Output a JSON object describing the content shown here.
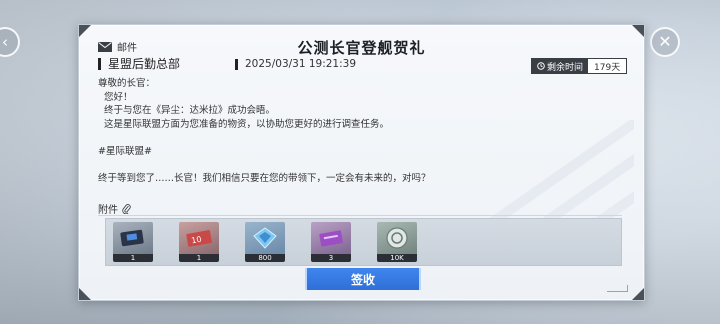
{
  "mail": {
    "label": "邮件",
    "title": "公测长官登舰贺礼",
    "sender": "星盟后勤总部",
    "date": "2025/03/31 19:21:39",
    "remaining_label": "剩余时间",
    "remaining_value": "179天",
    "body": {
      "greeting": "尊敬的长官：",
      "line1": "  您好！",
      "line2": "  终于与您在《异尘：达米拉》成功会晤。",
      "line3": "  这是星际联盟方面为您准备的物资，以协助您更好的进行调查任务。",
      "tag": "#星际联盟#",
      "closing": "终于等到您了……长官！我们相信只要在您的带领下，一定会有未来的，对吗？"
    },
    "attachments_label": "附件",
    "attachments": [
      {
        "icon": "dark-ticket-card-icon",
        "qty": "1",
        "color": "#3a4a66"
      },
      {
        "icon": "red-ticket-icon",
        "qty": "1",
        "color": "#b44a4a"
      },
      {
        "icon": "blue-crystal-icon",
        "qty": "800",
        "color": "#5aa8e6"
      },
      {
        "icon": "purple-card-icon",
        "qty": "3",
        "color": "#8a4ab0"
      },
      {
        "icon": "silver-coin-icon",
        "qty": "10K",
        "color": "#8fa39a"
      }
    ],
    "claim_button": "签收"
  },
  "colors": {
    "accent": "#3a7be6",
    "dark": "#3a3f46"
  }
}
